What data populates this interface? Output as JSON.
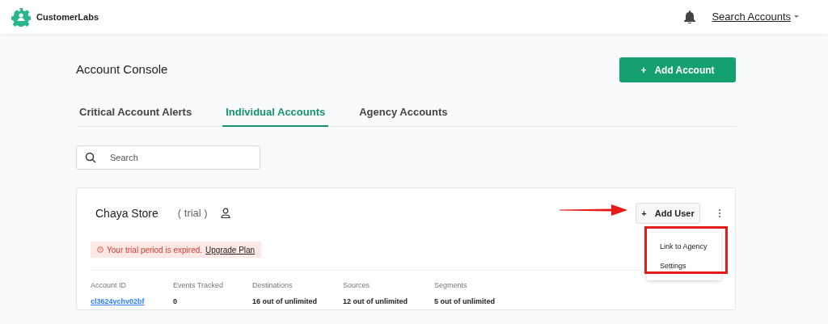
{
  "header": {
    "brand": "CustomerLabs",
    "account_menu": "Search Accounts"
  },
  "page_title": "Account Console",
  "add_account_button": "Add Account",
  "add_icon": "+",
  "tabs": [
    {
      "label": "Critical Account Alerts",
      "selected": false
    },
    {
      "label": "Individual Accounts",
      "selected": true
    },
    {
      "label": "Agency Accounts",
      "selected": false
    }
  ],
  "search": {
    "placeholder": "Search"
  },
  "account": {
    "name": "Chaya Store",
    "plan": "( trial )",
    "add_user_button": "Add User",
    "add_icon": "+",
    "alert": {
      "message": "Your trial period is expired.",
      "link": "Upgrade Plan"
    },
    "stats": [
      {
        "label": "Account ID",
        "value": "cl3624ychv02bf",
        "kind": "link"
      },
      {
        "label": "Events Tracked",
        "value": "0",
        "kind": "text"
      },
      {
        "label": "Destinations",
        "value": "16 out of unlimited",
        "kind": "text"
      },
      {
        "label": "Sources",
        "value": "12 out of unlimited",
        "kind": "text"
      },
      {
        "label": "Segments",
        "value": "5 out of unlimited",
        "kind": "text"
      }
    ],
    "menu": {
      "expanded": true,
      "items": [
        "Link to Agency",
        "Settings"
      ]
    }
  }
}
